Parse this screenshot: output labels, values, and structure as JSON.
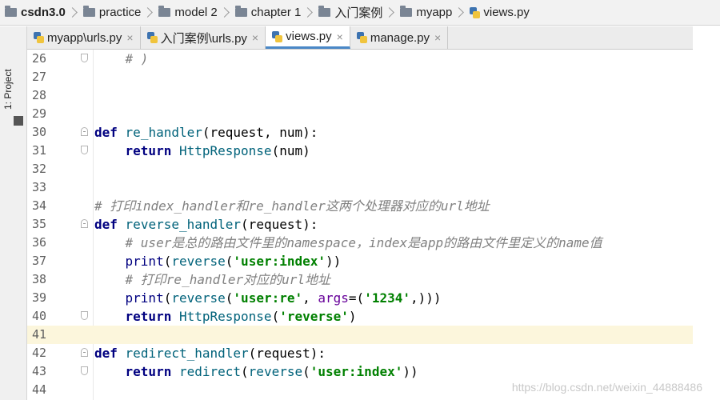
{
  "breadcrumb": [
    {
      "label": "csdn3.0",
      "icon": "folder-icon",
      "bold": true
    },
    {
      "label": "practice",
      "icon": "folder-icon"
    },
    {
      "label": "model 2",
      "icon": "folder-icon"
    },
    {
      "label": "chapter 1",
      "icon": "folder-icon"
    },
    {
      "label": "入门案例",
      "icon": "folder-icon"
    },
    {
      "label": "myapp",
      "icon": "folder-icon"
    },
    {
      "label": "views.py",
      "icon": "python-file-icon"
    }
  ],
  "sidebar": {
    "project_label": "1: Project"
  },
  "tabs": [
    {
      "label": "myapp\\urls.py",
      "close": "×",
      "active": false
    },
    {
      "label": "入门案例\\urls.py",
      "close": "×",
      "active": false
    },
    {
      "label": "views.py",
      "close": "×",
      "active": true
    },
    {
      "label": "manage.py",
      "close": "×",
      "active": false
    }
  ],
  "code_lines": [
    {
      "n": "26",
      "text": "    # )"
    },
    {
      "n": "27",
      "text": ""
    },
    {
      "n": "28",
      "text": ""
    },
    {
      "n": "29",
      "text": ""
    },
    {
      "n": "30",
      "text": "def re_handler(request, num):"
    },
    {
      "n": "31",
      "text": "    return HttpResponse(num)"
    },
    {
      "n": "32",
      "text": ""
    },
    {
      "n": "33",
      "text": ""
    },
    {
      "n": "34",
      "text": "# 打印index_handler和re_handler这两个处理器对应的url地址"
    },
    {
      "n": "35",
      "text": "def reverse_handler(request):"
    },
    {
      "n": "36",
      "text": "    # user是总的路由文件里的namespace，index是app的路由文件里定义的name值"
    },
    {
      "n": "37",
      "text": "    print(reverse('user:index'))"
    },
    {
      "n": "38",
      "text": "    # 打印re_handler对应的url地址"
    },
    {
      "n": "39",
      "text": "    print(reverse('user:re', args=('1234',)))"
    },
    {
      "n": "40",
      "text": "    return HttpResponse('reverse')"
    },
    {
      "n": "41",
      "text": ""
    },
    {
      "n": "42",
      "text": "def redirect_handler(request):"
    },
    {
      "n": "43",
      "text": "    return redirect(reverse('user:index'))"
    },
    {
      "n": "44",
      "text": ""
    }
  ],
  "current_line": "41",
  "watermark": "https://blog.csdn.net/weixin_44888486",
  "colors": {
    "keyword": "#000080",
    "string": "#008000",
    "comment": "#808080",
    "current_line": "#fcf6dc",
    "tab_active_underline": "#4a88c7"
  }
}
